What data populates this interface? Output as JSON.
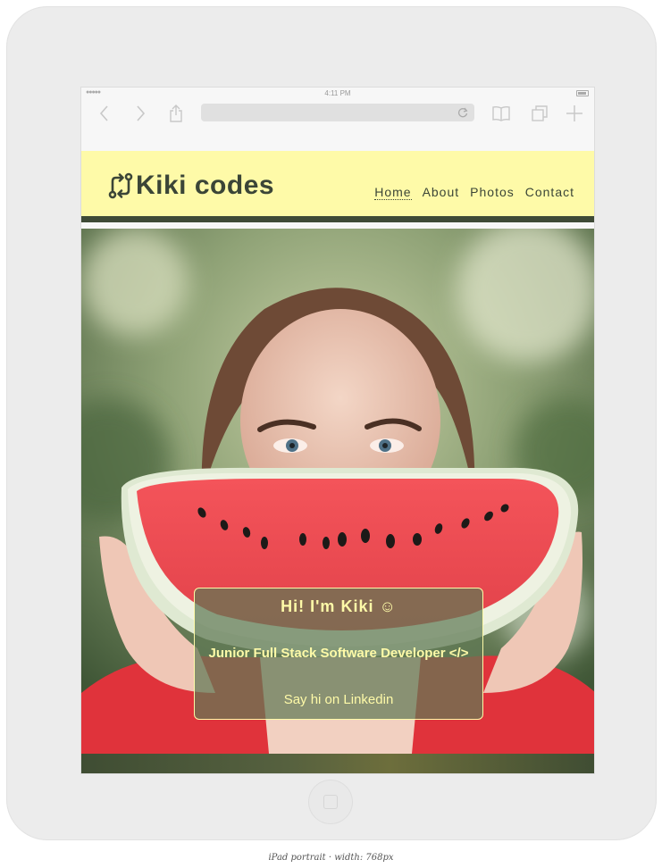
{
  "device": {
    "status_time": "4:11 PM",
    "caption": "iPad portrait · width: 768px"
  },
  "browser": {
    "back_icon": "chevron-left-icon",
    "forward_icon": "chevron-right-icon",
    "share_icon": "share-icon",
    "reload_icon": "reload-icon",
    "bookmarks_icon": "book-icon",
    "tabs_icon": "tabs-icon",
    "new_tab_icon": "plus-icon"
  },
  "site": {
    "logo_text": "Kiki codes",
    "logo_icon": "git-compare-icon",
    "nav": [
      {
        "label": "Home",
        "active": true
      },
      {
        "label": "About",
        "active": false
      },
      {
        "label": "Photos",
        "active": false
      },
      {
        "label": "Contact",
        "active": false
      }
    ],
    "hero": {
      "greeting": "Hi! I'm Kiki ☺",
      "role": "Junior Full Stack Software Developer </>",
      "linkedin": "Say hi on Linkedin"
    },
    "colors": {
      "header_bg": "#fefaa8",
      "accent_dark": "#3e4a36",
      "card_text": "#fefaa8"
    }
  }
}
